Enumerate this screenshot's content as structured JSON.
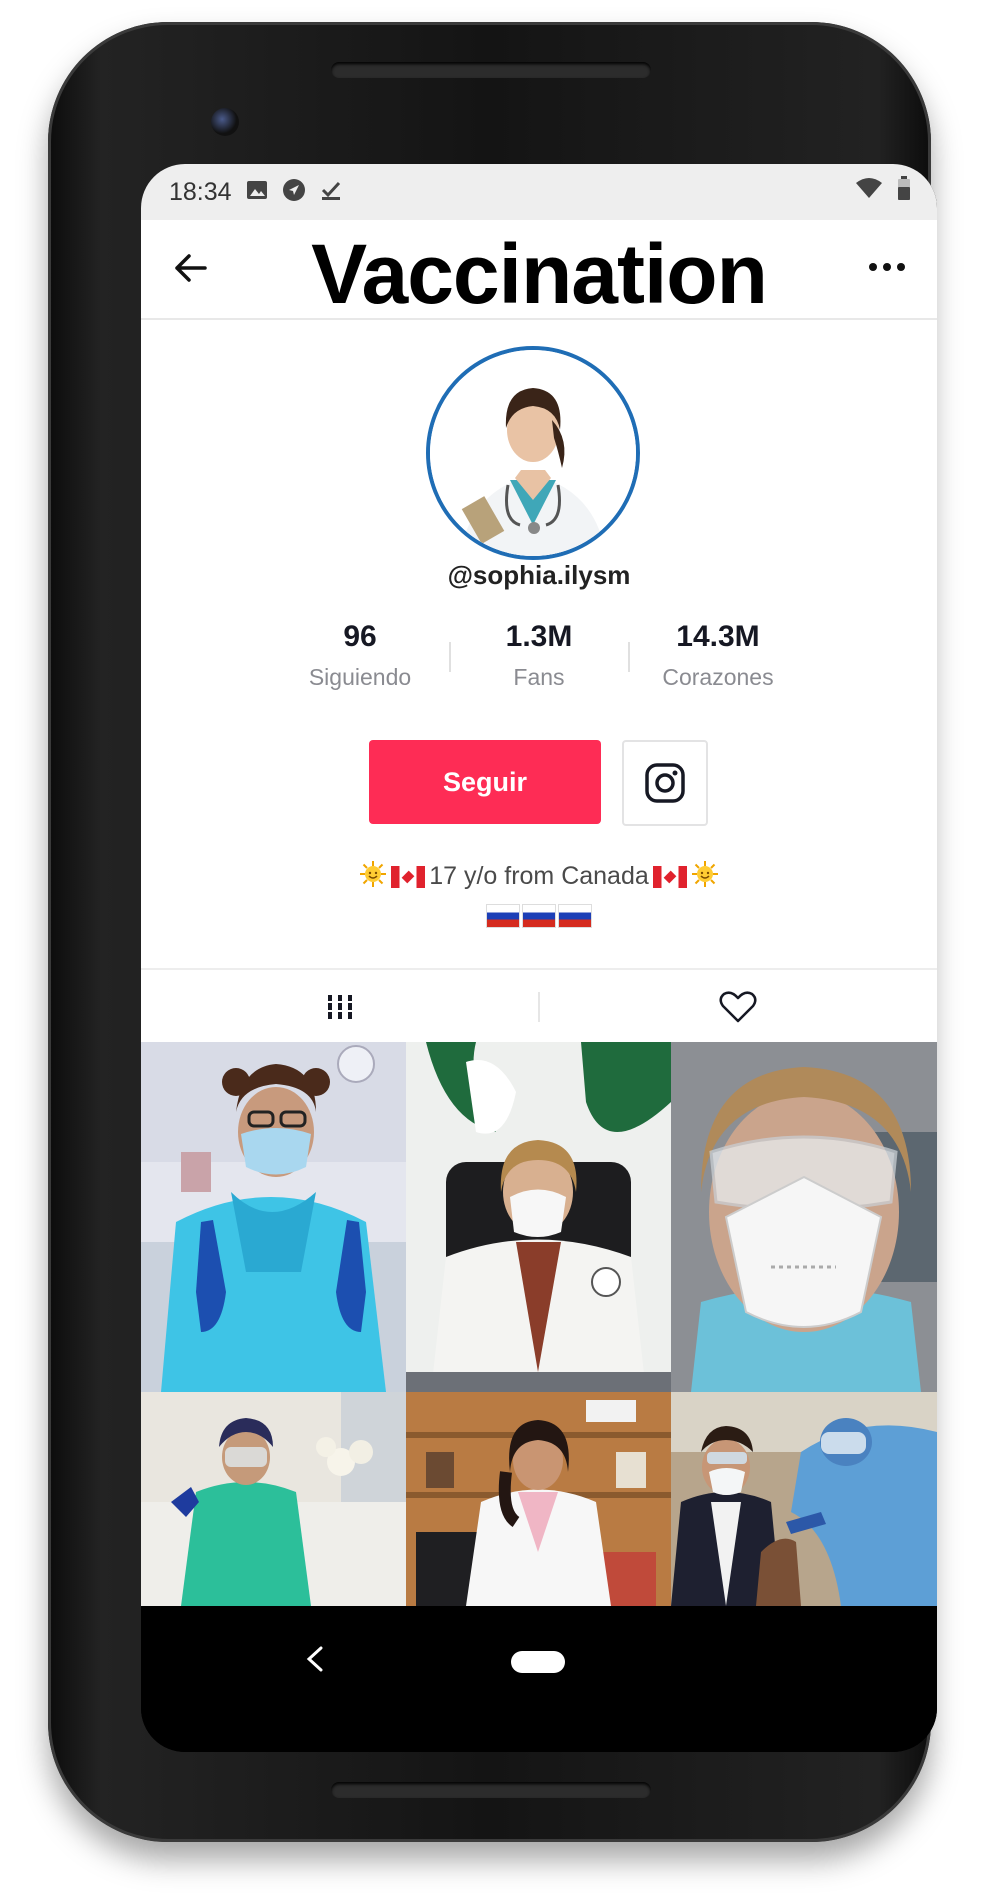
{
  "status_bar": {
    "time": "18:34",
    "icons": [
      "image-icon",
      "location-arrow-icon",
      "download-done-icon",
      "wifi-icon",
      "battery-icon"
    ]
  },
  "header": {
    "title": "Vaccination",
    "back_icon": "back-arrow-icon",
    "more_icon": "more-dots-icon"
  },
  "profile": {
    "username": "@sophia.ilysm",
    "stats": [
      {
        "value": "96",
        "label": "Siguiendo"
      },
      {
        "value": "1.3M",
        "label": "Fans"
      },
      {
        "value": "14.3M",
        "label": "Corazones"
      }
    ],
    "follow_label": "Seguir",
    "bio": "17 y/o from Canada",
    "bio_emoji": [
      "sun-emoji",
      "canada-flag",
      "russia-flag"
    ]
  },
  "tabs": [
    {
      "icon": "video-grid-icon"
    },
    {
      "icon": "heart-outline-icon"
    }
  ],
  "videos": [
    {
      "thumb": "nurse-in-blue-gown"
    },
    {
      "thumb": "doctor-at-desk"
    },
    {
      "thumb": "masked-health-worker"
    },
    {
      "thumb": "nurse-thumbs-up"
    },
    {
      "thumb": "doctor-in-office"
    },
    {
      "thumb": "vaccine-injection"
    }
  ],
  "colors": {
    "follow_button": "#fe2c55",
    "avatar_ring": "#1f6db5",
    "status_bar": "#eeeeee"
  }
}
